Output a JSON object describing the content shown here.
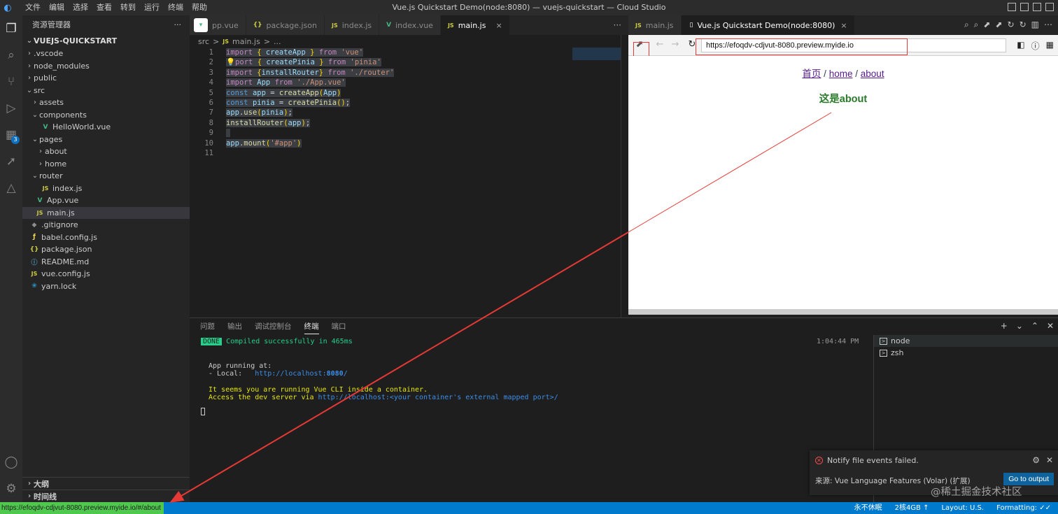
{
  "window": {
    "title": "Vue.js Quickstart Demo(node:8080) — vuejs-quickstart — Cloud Studio",
    "menu": [
      "文件",
      "编辑",
      "选择",
      "查看",
      "转到",
      "运行",
      "终端",
      "帮助"
    ]
  },
  "activity": {
    "extensions_badge": "3"
  },
  "sidebar": {
    "header": "资源管理器",
    "more": "···",
    "project": "VUEJS-QUICKSTART",
    "tree": [
      {
        "label": ".vscode",
        "depth": 0,
        "type": "folder"
      },
      {
        "label": "node_modules",
        "depth": 0,
        "type": "folder"
      },
      {
        "label": "public",
        "depth": 0,
        "type": "folder"
      },
      {
        "label": "src",
        "depth": 0,
        "type": "folder-open"
      },
      {
        "label": "assets",
        "depth": 1,
        "type": "folder"
      },
      {
        "label": "components",
        "depth": 1,
        "type": "folder-open"
      },
      {
        "label": "HelloWorld.vue",
        "depth": 2,
        "type": "vue"
      },
      {
        "label": "pages",
        "depth": 1,
        "type": "folder-open"
      },
      {
        "label": "about",
        "depth": 2,
        "type": "folder"
      },
      {
        "label": "home",
        "depth": 2,
        "type": "folder"
      },
      {
        "label": "router",
        "depth": 1,
        "type": "folder-open"
      },
      {
        "label": "index.js",
        "depth": 2,
        "type": "js"
      },
      {
        "label": "App.vue",
        "depth": 1,
        "type": "vue"
      },
      {
        "label": "main.js",
        "depth": 1,
        "type": "js",
        "selected": true
      },
      {
        "label": ".gitignore",
        "depth": 0,
        "type": "dot"
      },
      {
        "label": "babel.config.js",
        "depth": 0,
        "type": "babel"
      },
      {
        "label": "package.json",
        "depth": 0,
        "type": "json"
      },
      {
        "label": "README.md",
        "depth": 0,
        "type": "info"
      },
      {
        "label": "vue.config.js",
        "depth": 0,
        "type": "js"
      },
      {
        "label": "yarn.lock",
        "depth": 0,
        "type": "yarn"
      }
    ],
    "outline": "大纲",
    "timeline": "时间线"
  },
  "editor": {
    "tabs": [
      {
        "label": "pp.vue",
        "icon": "V",
        "kind": "vue"
      },
      {
        "label": "package.json",
        "icon": "{}",
        "kind": "json"
      },
      {
        "label": "index.js",
        "icon": "JS",
        "kind": "js"
      },
      {
        "label": "index.vue",
        "icon": "V",
        "kind": "vue"
      },
      {
        "label": "main.js",
        "icon": "JS",
        "kind": "js",
        "active": true
      }
    ],
    "more": "···",
    "close": "×",
    "breadcrumb": [
      "src",
      ">",
      "JS",
      "main.js",
      ">",
      "..."
    ],
    "line_numbers": [
      "1",
      "2",
      "3",
      "4",
      "5",
      "6",
      "7",
      "8",
      "9",
      "10",
      "11"
    ]
  },
  "preview": {
    "tabs": [
      {
        "label": "main.js",
        "icon": "JS"
      },
      {
        "label": "Vue.js Quickstart Demo(node:8080)",
        "active": true
      }
    ],
    "url": "https://efoqdv-cdjvut-8080.preview.myide.io",
    "page": {
      "nav": [
        "首页",
        "home",
        "about"
      ],
      "separator": "/",
      "heading": "这是about"
    }
  },
  "panel": {
    "tabs": [
      "问题",
      "输出",
      "调试控制台",
      "终端",
      "端口"
    ],
    "active_tab": "终端",
    "terminal": {
      "done_badge": "DONE",
      "compiled": "Compiled successfully in 465ms",
      "time": "1:04:44 PM",
      "running": "App running at:",
      "local_label": "- Local:   ",
      "local_url_prefix": "http://localhost:",
      "local_port": "8080",
      "local_url_suffix": "/",
      "container_msg": "It seems you are running Vue CLI inside a container.",
      "access_msg": "Access the dev server via ",
      "access_link": "http://localhost:<your container's external mapped port>/"
    },
    "terminals": [
      "node",
      "zsh"
    ]
  },
  "notification": {
    "message": "Notify file events failed.",
    "source": "来源: Vue Language Features (Volar) (扩展)",
    "button": "Go to output"
  },
  "watermark": "@稀土掘金技术社区",
  "statusbar": {
    "hover_url": "https://efoqdv-cdjvut-8080.preview.myide.io/#/about",
    "items": [
      "永不休眠",
      "2核4GB ↑",
      "Layout: U.S.",
      "Formatting: ✓✓"
    ]
  },
  "colors": {
    "accent": "#007acc",
    "vue_green": "#42b983",
    "annotation_red": "#e53935"
  }
}
